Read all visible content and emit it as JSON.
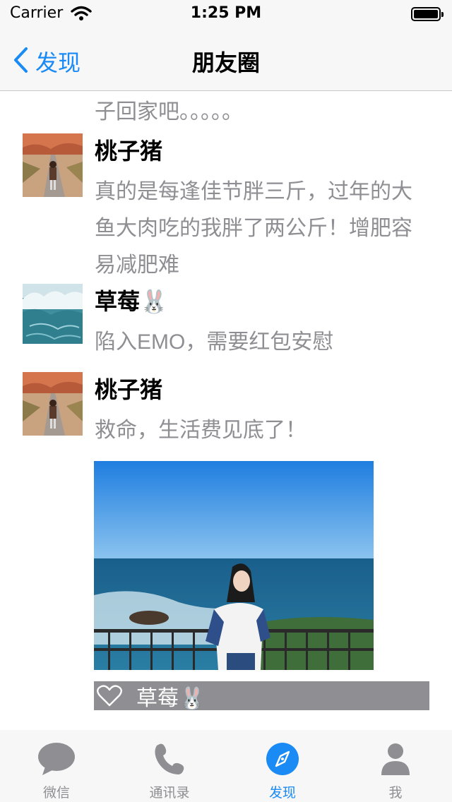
{
  "status_bar": {
    "carrier": "Carrier",
    "time": "1:25 PM"
  },
  "nav": {
    "back_label": "发现",
    "title": "朋友圈"
  },
  "feed": {
    "partial_text": "子回家吧。。。。。",
    "posts": [
      {
        "name": "桃子猪",
        "text": "真的是每逢佳节胖三斤，过年的大鱼大肉吃的我胖了两公斤！增肥容易减肥难"
      },
      {
        "name": "草莓🐰",
        "text": "陷入EMO，需要红包安慰"
      },
      {
        "name": "桃子猪",
        "text": "救命，生活费见底了！"
      }
    ],
    "likes": {
      "name": "草莓🐰"
    }
  },
  "tabbar": {
    "tabs": [
      {
        "label": "微信",
        "icon": "chat-bubble-icon"
      },
      {
        "label": "通讯录",
        "icon": "phone-icon"
      },
      {
        "label": "发现",
        "icon": "compass-icon",
        "active": true
      },
      {
        "label": "我",
        "icon": "person-icon"
      }
    ]
  },
  "colors": {
    "accent": "#1a8af5",
    "inactive": "#8e8e93",
    "bar_bg": "#f7f7f7"
  }
}
